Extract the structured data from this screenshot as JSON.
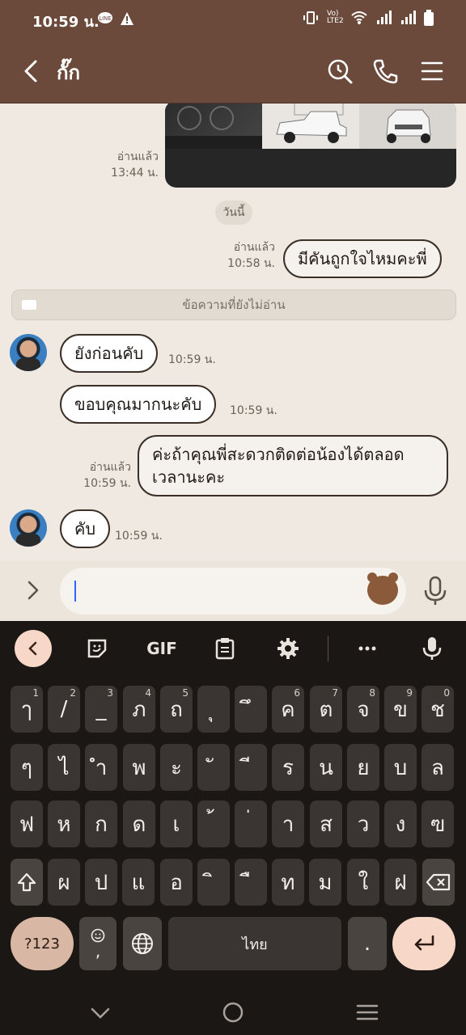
{
  "status_bar": {
    "time": "10:59 น.",
    "network_label": "Vo) LTE2"
  },
  "header": {
    "title": "กั๊ก"
  },
  "chat": {
    "image_read": "อ่านแล้ว",
    "image_time": "13:44 น.",
    "date_divider": "วันนี้",
    "unread_divider": "ข้อความที่ยังไม่อ่าน",
    "messages": [
      {
        "side": "self",
        "text": "มีคันถูกใจไหมคะพี่",
        "read": "อ่านแล้ว",
        "time": "10:58 น."
      },
      {
        "side": "other",
        "text": "ยังก่อนคับ",
        "time": "10:59 น."
      },
      {
        "side": "other",
        "text": "ขอบคุณมากนะคับ",
        "time": "10:59 น."
      },
      {
        "side": "self",
        "text_line1": "ค่ะถ้าคุณพี่สะดวกติดต่อน้องได้ตลอด",
        "text_line2": "เวลานะคะ",
        "read": "อ่านแล้ว",
        "time": "10:59 น."
      },
      {
        "side": "other",
        "text": "คับ",
        "time": "10:59 น."
      }
    ]
  },
  "input": {
    "placeholder": ""
  },
  "keyboard": {
    "gif_label": "GIF",
    "row1": [
      {
        "k": "ๅ",
        "h": "1"
      },
      {
        "k": "/",
        "h": "2"
      },
      {
        "k": "_",
        "h": "3"
      },
      {
        "k": "ภ",
        "h": "4"
      },
      {
        "k": "ถ",
        "h": "5"
      },
      {
        "k": "ุ",
        "h": ""
      },
      {
        "k": "ึ",
        "h": ""
      },
      {
        "k": "ค",
        "h": "6"
      },
      {
        "k": "ต",
        "h": "7"
      },
      {
        "k": "จ",
        "h": "8"
      },
      {
        "k": "ข",
        "h": "9"
      },
      {
        "k": "ช",
        "h": "0"
      }
    ],
    "row2": [
      "ๆ",
      "ไ",
      "ำ",
      "พ",
      "ะ",
      "ั",
      "ี",
      "ร",
      "น",
      "ย",
      "บ",
      "ล"
    ],
    "row3": [
      "ฟ",
      "ห",
      "ก",
      "ด",
      "เ",
      "้",
      "่",
      "า",
      "ส",
      "ว",
      "ง",
      "ฃ"
    ],
    "row4": [
      "ผ",
      "ป",
      "แ",
      "อ",
      "ิ",
      "ื",
      "ท",
      "ม",
      "ใ",
      "ฝ"
    ],
    "symbols_label": "?123",
    "emoji_comma": ",",
    "space_label": "ไทย",
    "period": "."
  },
  "colors": {
    "header_bg": "#6b4a3c",
    "chat_bg": "#efe9e1",
    "keyboard_bg": "#1b1715",
    "accent_key": "#f7d7c7"
  }
}
